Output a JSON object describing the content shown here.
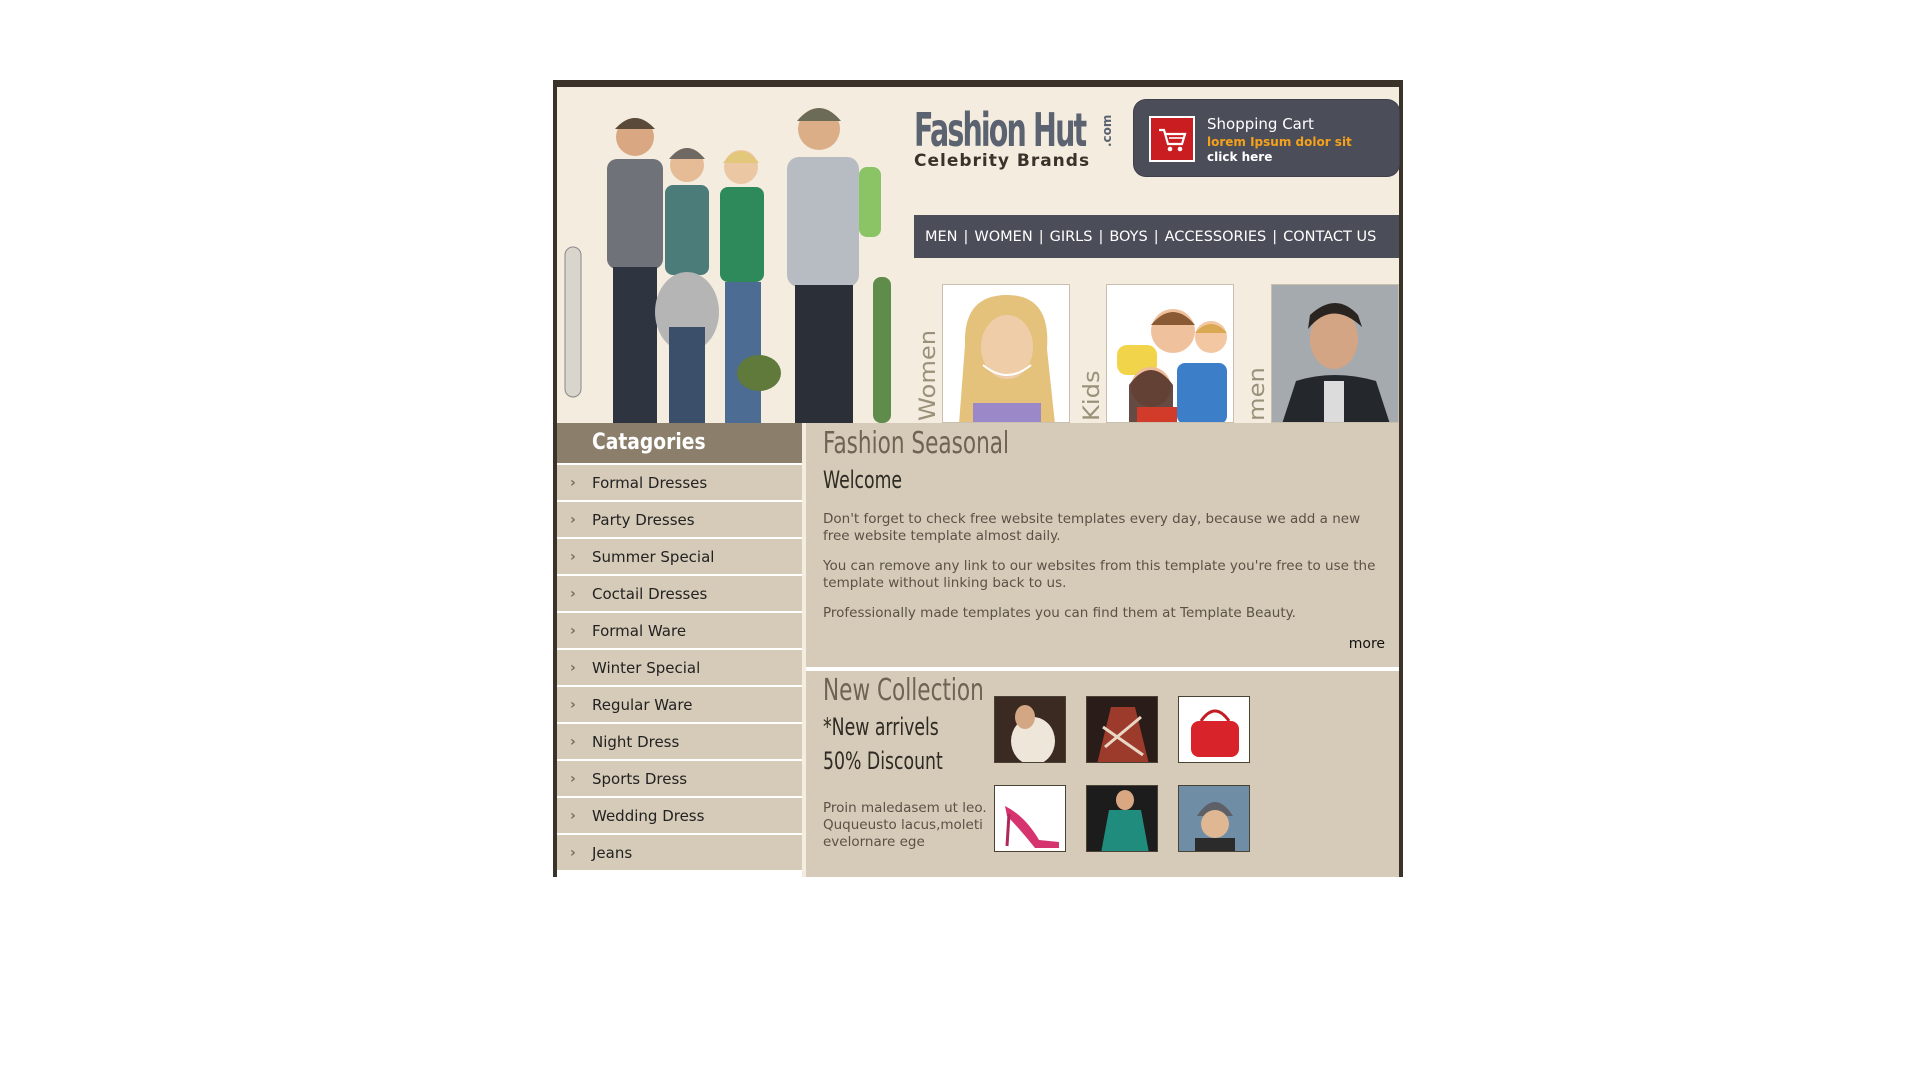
{
  "header": {
    "logo_main": "Fashion Hut",
    "logo_com": ".com",
    "logo_sub": "Celebrity Brands"
  },
  "cart": {
    "title": "Shopping Cart",
    "text": "lorem Ipsum dolor sit",
    "link": "click here",
    "icon": "shopping-cart-icon"
  },
  "nav": {
    "items": [
      "MEN",
      "WOMEN",
      "GIRLS",
      "BOYS",
      "ACCESSORIES",
      "CONTACT US"
    ],
    "separator": "|"
  },
  "tiles": [
    {
      "label": "Women"
    },
    {
      "label": "Kids"
    },
    {
      "label": "men"
    }
  ],
  "sidebar": {
    "title": "Catagories",
    "items": [
      "Formal Dresses",
      "Party Dresses",
      "Summer Special",
      "Coctail Dresses",
      "Formal Ware",
      "Winter Special",
      "Regular Ware",
      "Night Dress",
      "Sports Dress",
      "Wedding Dress",
      "Jeans"
    ],
    "arrow_icon": "chevron-right-icon"
  },
  "welcome": {
    "title": "Fashion Seasonal",
    "subtitle": "Welcome",
    "paragraphs": [
      "Don't forget to check free website templates every day, because we add a new free website template almost daily.",
      "You can remove any link to our websites from this template you're free to use the template without linking back to us.",
      "Professionally made templates you can find them at Template Beauty."
    ],
    "more": "more"
  },
  "collection": {
    "title": "New Collection",
    "line1": "*New arrivels",
    "line2": "50% Discount",
    "text": "Proin maledasem ut leo. Ququeusto lacus,moletievelornare ege"
  },
  "colors": {
    "nav_bg": "#4b4e59",
    "panel_bg": "#d6cbb8",
    "sidebar_title_bg": "#8b7e6a",
    "header_bg": "#f4ecdf",
    "cart_accent": "#f6a11a",
    "cart_icon_bg": "#c91d22"
  }
}
